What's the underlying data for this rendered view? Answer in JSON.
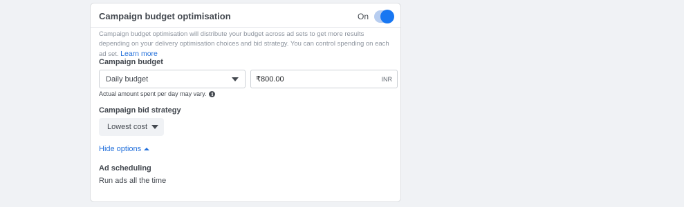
{
  "header": {
    "title": "Campaign budget optimisation",
    "toggle_label": "On",
    "toggle_state": "on"
  },
  "description": {
    "text": "Campaign budget optimisation will distribute your budget across ad sets to get more results depending on your delivery optimisation choices and bid strategy. You can control spending on each ad set.",
    "link": "Learn more"
  },
  "budget": {
    "label": "Campaign budget",
    "type_selected": "Daily budget",
    "amount": "₹800.00",
    "currency": "INR",
    "hint": "Actual amount spent per day may vary."
  },
  "bid": {
    "label": "Campaign bid strategy",
    "selected": "Lowest cost"
  },
  "options": {
    "toggle_label": "Hide options"
  },
  "scheduling": {
    "label": "Ad scheduling",
    "value": "Run ads all the time"
  },
  "colors": {
    "accent": "#1877f2",
    "link": "#216fdb",
    "background": "#f0f2f5"
  }
}
